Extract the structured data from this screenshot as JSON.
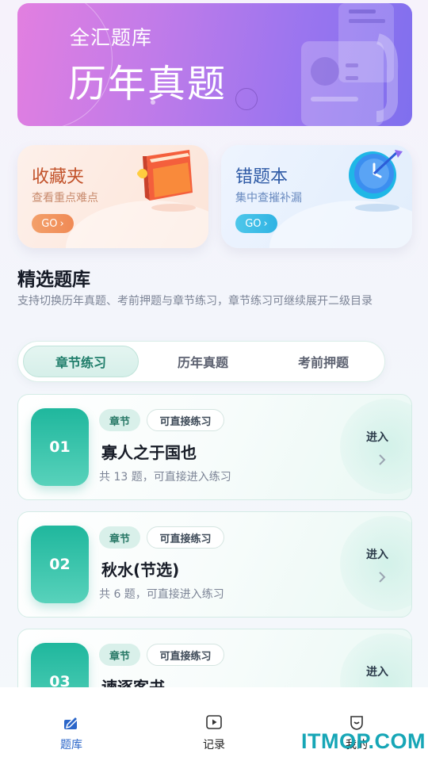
{
  "banner": {
    "subtitle": "全汇题库",
    "title": "历年真题"
  },
  "quick_cards": [
    {
      "title": "收藏夹",
      "desc": "查看重点难点",
      "button": "GO",
      "icon": "red-book-icon"
    },
    {
      "title": "错题本",
      "desc": "集中查摧补漏",
      "button": "GO",
      "icon": "target-clock-icon"
    }
  ],
  "section": {
    "title": "精选题库",
    "desc": "支持切换历年真题、考前押题与章节练习，章节练习可继续展开二级目录"
  },
  "tabs": [
    {
      "label": "章节练习",
      "active": true
    },
    {
      "label": "历年真题",
      "active": false
    },
    {
      "label": "考前押题",
      "active": false
    }
  ],
  "items": [
    {
      "num": "01",
      "tag": "章节",
      "tag2": "可直接练习",
      "title": "寡人之于国也",
      "meta": "共 13 题，可直接进入练习",
      "action": "进入"
    },
    {
      "num": "02",
      "tag": "章节",
      "tag2": "可直接练习",
      "title": "秋水(节选)",
      "meta": "共 6 题，可直接进入练习",
      "action": "进入"
    },
    {
      "num": "03",
      "tag": "章节",
      "tag2": "可直接练习",
      "title": "谏逐客书",
      "meta": "",
      "action": "进入"
    }
  ],
  "bottom_nav": [
    {
      "label": "题库",
      "icon": "pencil-book-icon",
      "active": true
    },
    {
      "label": "记录",
      "icon": "play-record-icon",
      "active": false
    },
    {
      "label": "我的",
      "icon": "profile-shield-icon",
      "active": false
    }
  ],
  "watermark": "ITMOP.COM",
  "colors": {
    "accent": "#1fb79d",
    "nav_active": "#2b66c9",
    "banner_start": "#e27fe0",
    "banner_end": "#7f6fee"
  }
}
